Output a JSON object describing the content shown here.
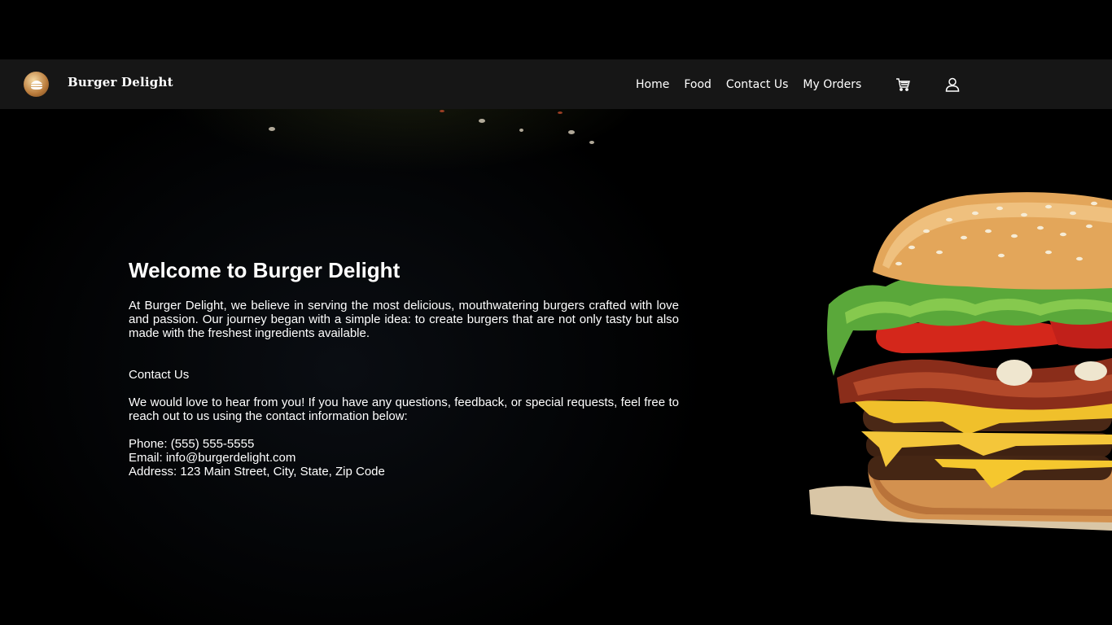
{
  "header": {
    "brand": "Burger Delight",
    "nav": [
      "Home",
      "Food",
      "Contact Us",
      "My Orders"
    ],
    "icons": [
      "burger-logo-icon",
      "cart-icon",
      "user-icon"
    ]
  },
  "main": {
    "title": "Welcome to Burger Delight",
    "intro": "At Burger Delight, we believe in serving the most delicious, mouthwatering burgers crafted with love and passion. Our journey began with a simple idea: to create burgers that are not only tasty but also made with the freshest ingredients available.",
    "contact_heading": "Contact Us",
    "contact_text": "We would love to hear from you! If you have any questions, feedback, or special requests, feel free to reach out to us using the contact information below:",
    "phone": "Phone: (555) 555-5555",
    "email": "Email: info@burgerdelight.com",
    "address": "Address: 123 Main Street, City, State, Zip Code"
  },
  "colors": {
    "background": "#000000",
    "navbar": "#161616",
    "text": "#ffffff"
  }
}
